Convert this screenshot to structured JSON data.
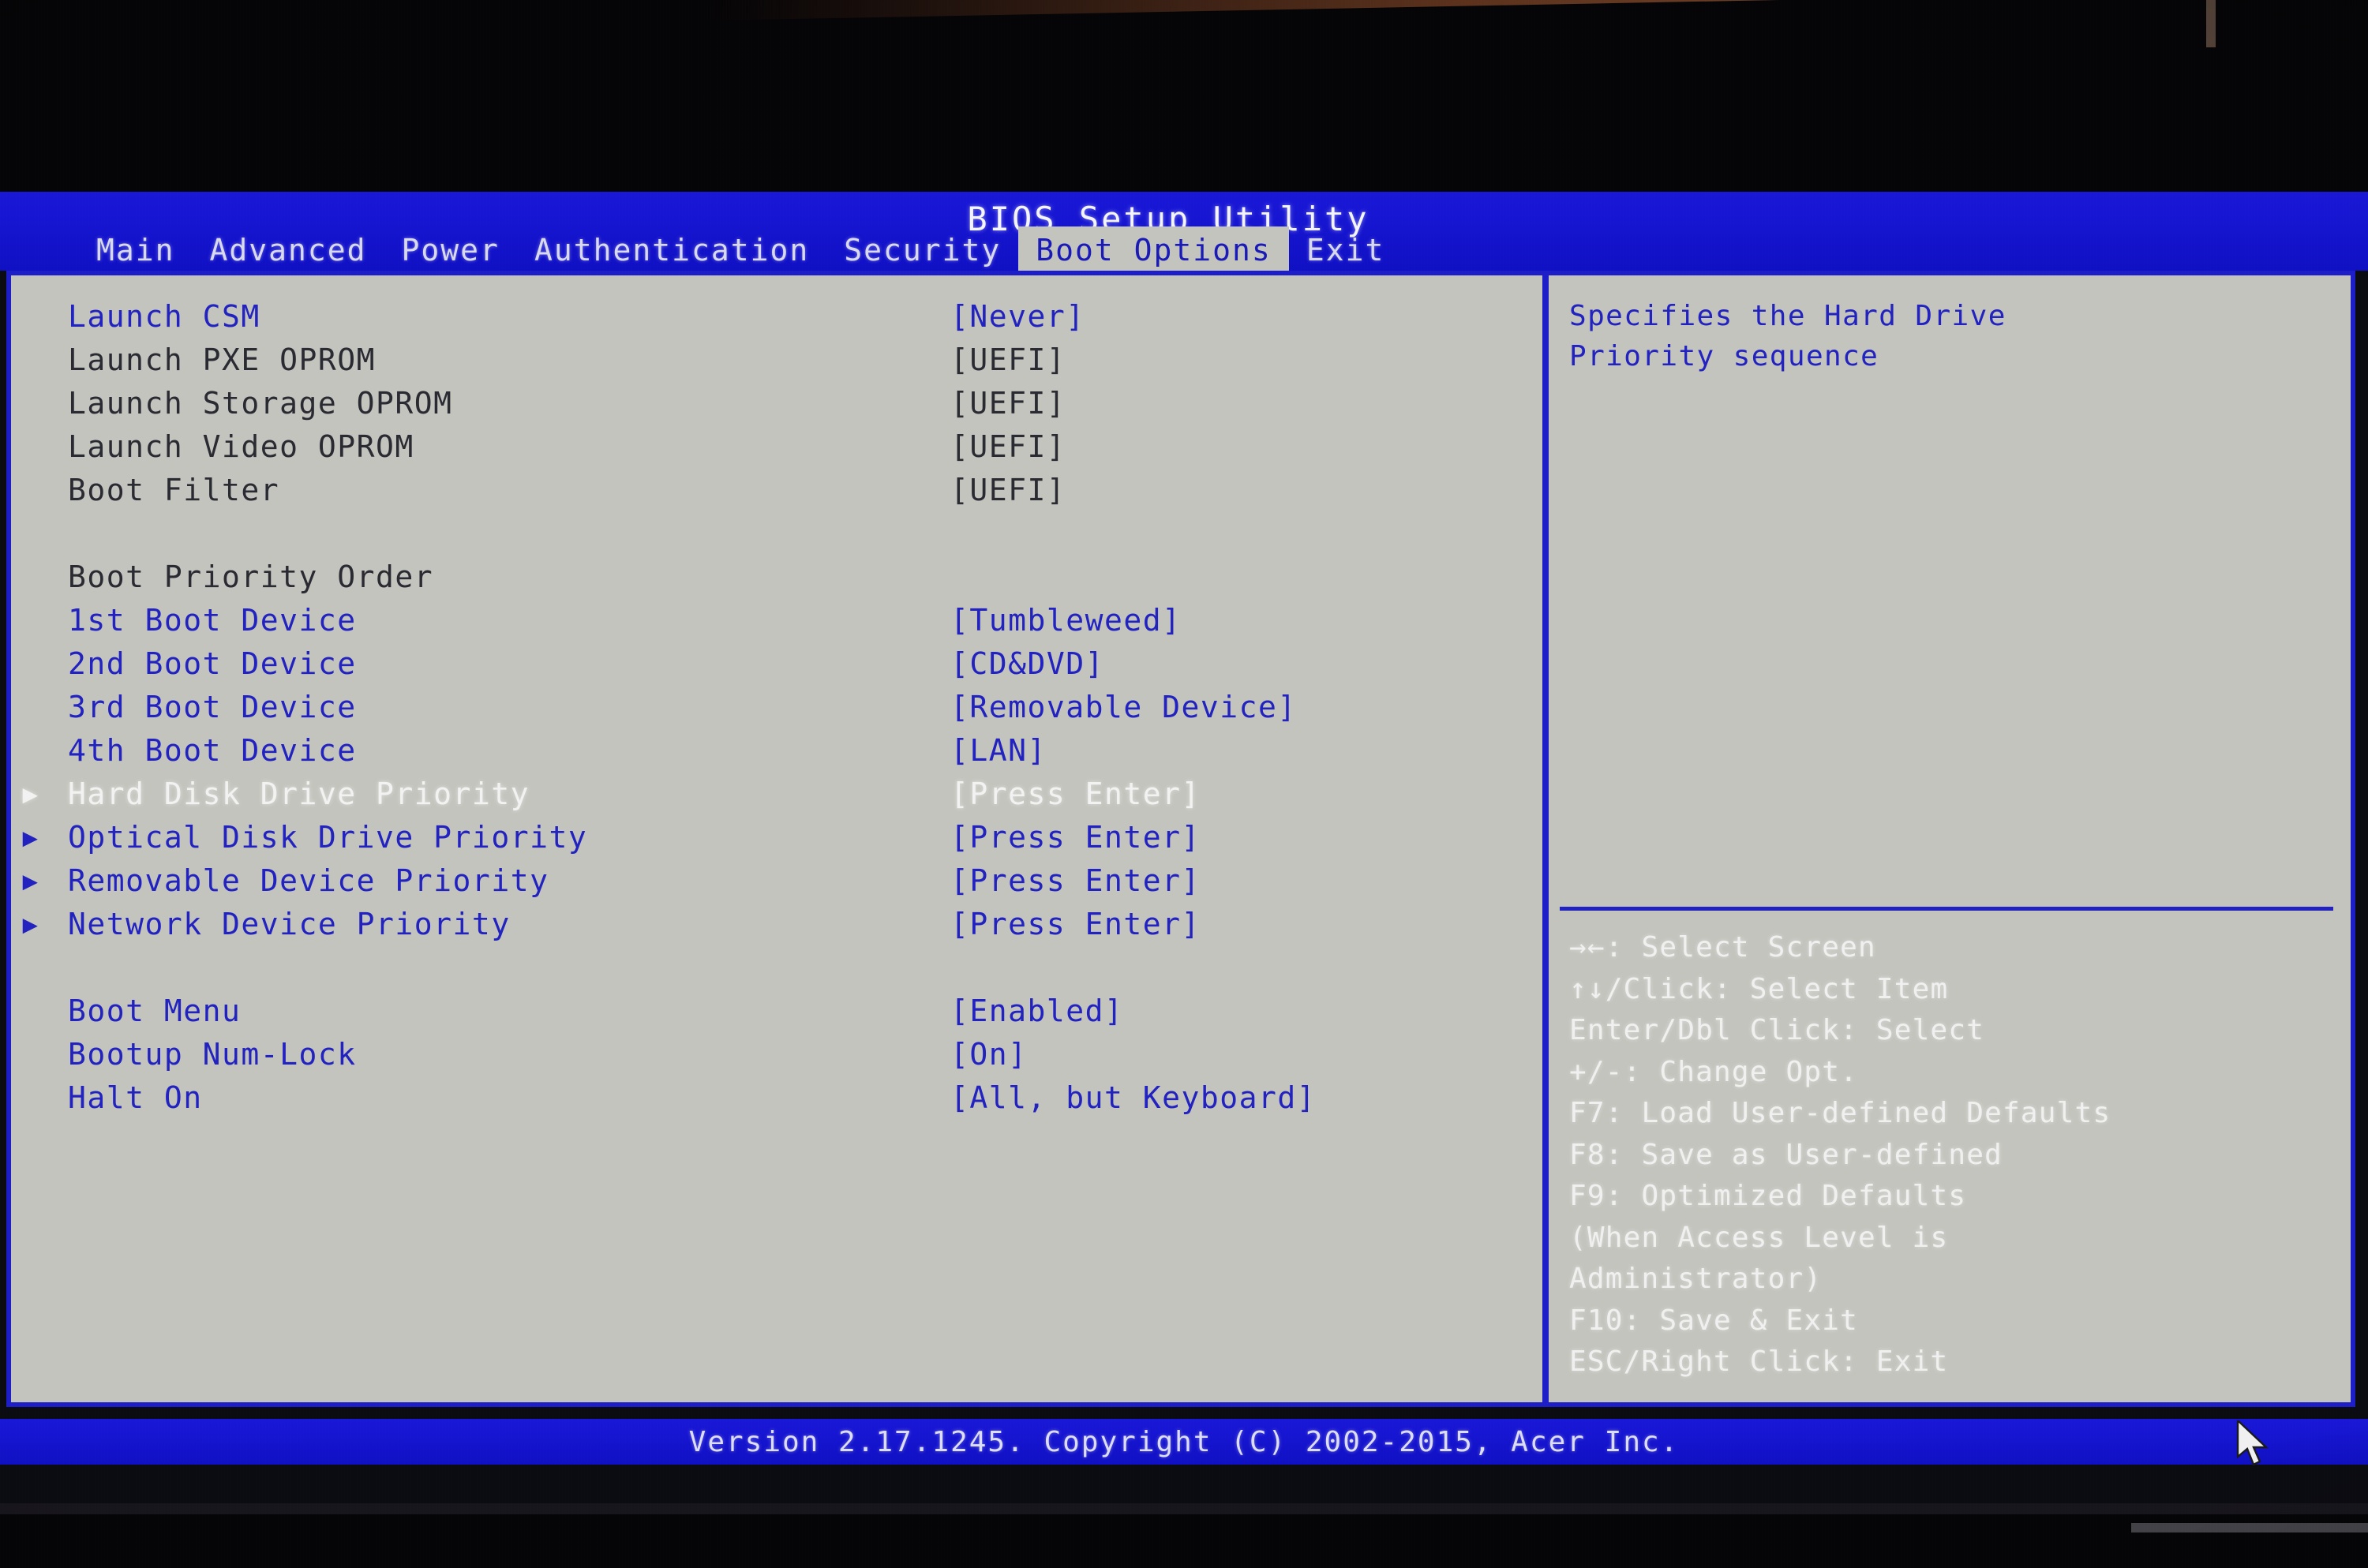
{
  "window": {
    "title": "BIOS Setup Utility"
  },
  "menubar": {
    "tabs": [
      {
        "label": "Main",
        "active": false
      },
      {
        "label": "Advanced",
        "active": false
      },
      {
        "label": "Power",
        "active": false
      },
      {
        "label": "Authentication",
        "active": false
      },
      {
        "label": "Security",
        "active": false
      },
      {
        "label": "Boot Options",
        "active": true
      },
      {
        "label": "Exit",
        "active": false
      }
    ]
  },
  "settings": {
    "rows": [
      {
        "marker": "",
        "label": "Launch CSM",
        "value": "[Never]",
        "state": "highlight"
      },
      {
        "marker": "",
        "label": "Launch PXE OPROM",
        "value": "[UEFI]",
        "state": "dark"
      },
      {
        "marker": "",
        "label": "Launch Storage OPROM",
        "value": "[UEFI]",
        "state": "dark"
      },
      {
        "marker": "",
        "label": "Launch Video OPROM",
        "value": "[UEFI]",
        "state": "dark"
      },
      {
        "marker": "",
        "label": "Boot Filter",
        "value": "[UEFI]",
        "state": "dark"
      },
      {
        "marker": "",
        "label": "",
        "value": "",
        "state": "spacer"
      },
      {
        "marker": "",
        "label": "Boot Priority Order",
        "value": "",
        "state": "dark"
      },
      {
        "marker": "",
        "label": "1st Boot Device",
        "value": "[Tumbleweed]",
        "state": "normal"
      },
      {
        "marker": "",
        "label": "2nd Boot Device",
        "value": "[CD&DVD]",
        "state": "normal"
      },
      {
        "marker": "",
        "label": "3rd Boot Device",
        "value": "[Removable Device]",
        "state": "normal"
      },
      {
        "marker": "",
        "label": "4th Boot Device",
        "value": "[LAN]",
        "state": "normal"
      },
      {
        "marker": "▶",
        "label": "Hard Disk Drive Priority",
        "value": "[Press Enter]",
        "state": "selected"
      },
      {
        "marker": "▶",
        "label": "Optical Disk Drive Priority",
        "value": "[Press Enter]",
        "state": "normal"
      },
      {
        "marker": "▶",
        "label": "Removable Device Priority",
        "value": "[Press Enter]",
        "state": "normal"
      },
      {
        "marker": "▶",
        "label": "Network Device Priority",
        "value": "[Press Enter]",
        "state": "normal"
      },
      {
        "marker": "",
        "label": "",
        "value": "",
        "state": "spacer"
      },
      {
        "marker": "",
        "label": "Boot Menu",
        "value": "[Enabled]",
        "state": "normal"
      },
      {
        "marker": "",
        "label": "Bootup Num-Lock",
        "value": "[On]",
        "state": "normal"
      },
      {
        "marker": "",
        "label": "Halt On",
        "value": "[All, but Keyboard]",
        "state": "normal"
      }
    ]
  },
  "help": {
    "description_lines": [
      "Specifies the Hard Drive",
      "Priority sequence"
    ],
    "legend_lines": [
      "→←: Select Screen",
      "↑↓/Click: Select Item",
      "Enter/Dbl Click: Select",
      "+/-: Change Opt.",
      "F7: Load User-defined Defaults",
      "F8: Save as User-defined",
      "F9: Optimized Defaults",
      "(When Access Level is",
      "Administrator)",
      "F10: Save & Exit",
      "ESC/Right Click: Exit"
    ]
  },
  "footer": {
    "text": "Version 2.17.1245. Copyright (C) 2002-2015, Acer Inc."
  },
  "colors": {
    "header_blue": "#1414cf",
    "panel_gray": "#c3c4bd",
    "item_blue": "#2222c0",
    "item_dark": "#2a2a32",
    "selected_white": "#f2f2f2"
  }
}
